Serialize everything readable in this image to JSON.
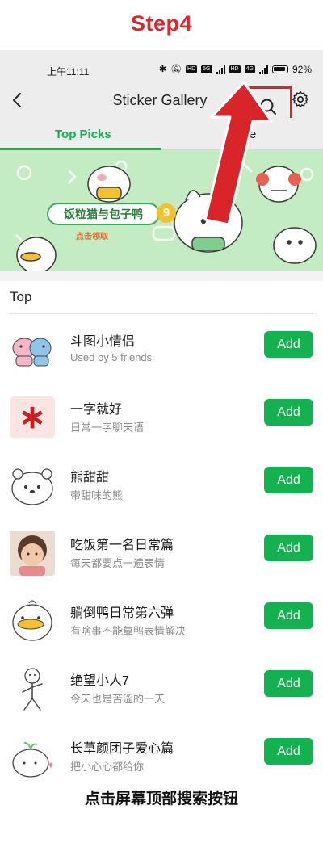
{
  "step_title": "Step4",
  "status": {
    "time": "上午11:11",
    "battery": "92%",
    "network_tags": [
      "5G",
      "4G"
    ]
  },
  "appbar": {
    "title": "Sticker Gallery"
  },
  "tabs": [
    {
      "label": "Top Picks"
    },
    {
      "label": "More"
    }
  ],
  "banner": {
    "label": "饭粒猫与包子鸭",
    "badge": "9",
    "sub": "点击领取"
  },
  "section": {
    "title": "Top"
  },
  "stickers": [
    {
      "title": "斗图小情侣",
      "subtitle": "Used by 5 friends",
      "add": "Add",
      "icon": "couple-sticker-icon"
    },
    {
      "title": "一字就好",
      "subtitle": "日常一字聊天语",
      "add": "Add",
      "icon": "red-character-icon"
    },
    {
      "title": "熊甜甜",
      "subtitle": "带甜味的熊",
      "add": "Add",
      "icon": "white-bear-icon"
    },
    {
      "title": "吃饭第一名日常篇",
      "subtitle": "每天都要点一遍表情",
      "add": "Add",
      "icon": "child-photo-icon"
    },
    {
      "title": "躺倒鸭日常第六弹",
      "subtitle": "有啥事不能靠鸭表情解决",
      "add": "Add",
      "icon": "duck-sticker-icon"
    },
    {
      "title": "绝望小人7",
      "subtitle": "今天也是苦涩的一天",
      "add": "Add",
      "icon": "stick-figure-icon"
    },
    {
      "title": "长草颜团子爱心篇",
      "subtitle": "把小心心都给你",
      "add": "Add",
      "icon": "sprout-bun-icon"
    }
  ],
  "caption": "点击屏幕顶部搜索按钮",
  "colors": {
    "accent": "#12b24e",
    "highlight": "#d9242a",
    "bar": "#ededed"
  }
}
